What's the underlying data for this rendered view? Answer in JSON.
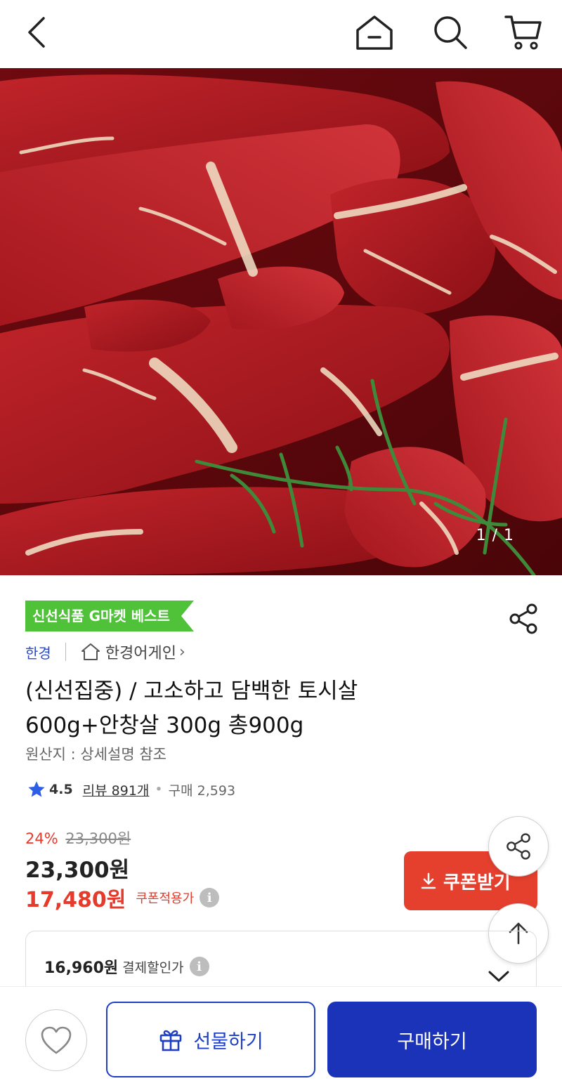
{
  "header": {
    "icons": [
      "back-icon",
      "home-icon",
      "search-icon",
      "cart-icon"
    ]
  },
  "hero": {
    "image_counter": "1 / 1"
  },
  "product": {
    "badge": "신선식품 G마켓 베스트",
    "seller_brand": "한경",
    "store_name": "한경어게인",
    "title_line1": "(신선집중) / 고소하고 담백한 토시살",
    "title_line2": "600g+안창살 300g 총900g",
    "origin": "원산지 : 상세설명 참조",
    "rating": "4.5",
    "review_text": "리뷰 891개",
    "purchase_text": "구매 2,593"
  },
  "price": {
    "discount_rate": "24%",
    "original_price": "23,300원",
    "sale_price": "23,300원",
    "coupon_price": "17,480원",
    "coupon_price_label": "쿠폰적용가",
    "coupon_button": "쿠폰받기",
    "payment_price": "16,960원",
    "payment_label": "결제할인가",
    "info_glyph": "i"
  },
  "bottom": {
    "gift_label": "선물하기",
    "buy_label": "구매하기"
  },
  "colors": {
    "accent_blue": "#1b33b8",
    "accent_red": "#e53f2e",
    "badge_green": "#4fc23a"
  }
}
